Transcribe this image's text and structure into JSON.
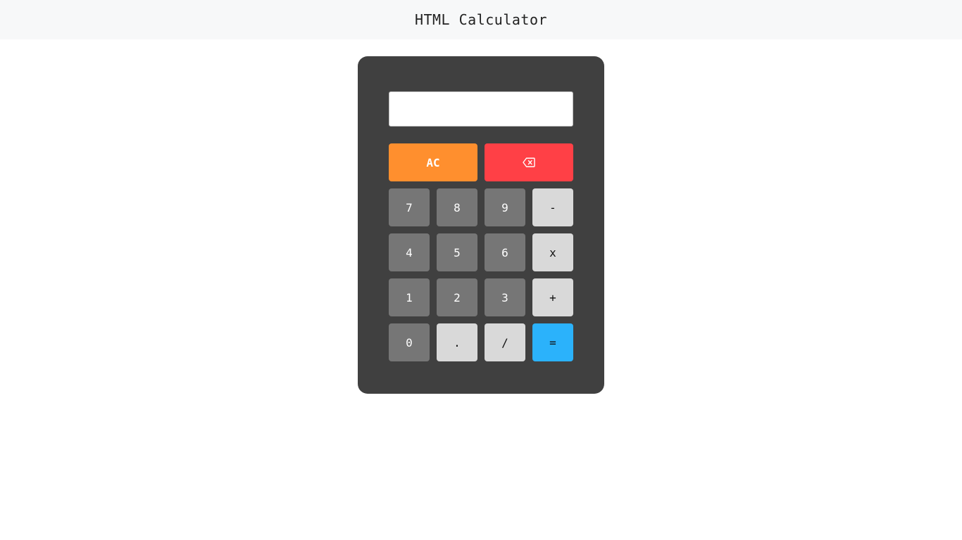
{
  "header": {
    "title": "HTML Calculator"
  },
  "display": {
    "value": ""
  },
  "buttons": {
    "clear": "AC",
    "backspace_icon": "backspace-icon",
    "seven": "7",
    "eight": "8",
    "nine": "9",
    "minus": "-",
    "four": "4",
    "five": "5",
    "six": "6",
    "multiply": "x",
    "one": "1",
    "two": "2",
    "three": "3",
    "plus": "+",
    "zero": "0",
    "dot": ".",
    "divide": "/",
    "equals": "="
  },
  "colors": {
    "calculator_body": "#404040",
    "number_key": "#767676",
    "operator_key": "#d9d9d9",
    "clear_key": "#ff8f2e",
    "backspace_key": "#ff4046",
    "equals_key": "#2bb2fb"
  }
}
